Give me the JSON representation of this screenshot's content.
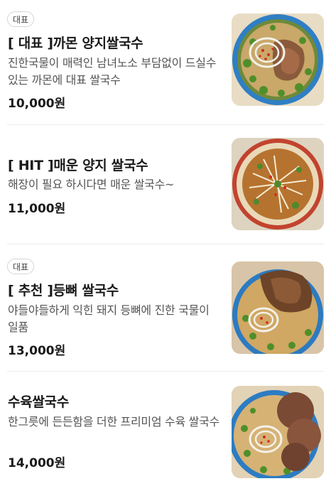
{
  "menu": {
    "currency_suffix": "원",
    "items": [
      {
        "badge": "대표",
        "title": "[ 대표 ]까몬 양지쌀국수",
        "description": "진한국물이 매력인 남녀노소 부담없이 드실수 있는 까몬에 대표 쌀국수",
        "price": "10,000원",
        "image_icon": "beef-brisket-pho-photo"
      },
      {
        "badge": "",
        "title": "[ HIT ]매운 양지 쌀국수",
        "description": "해장이 필요 하시다면 매운 쌀국수~",
        "price": "11,000원",
        "image_icon": "spicy-brisket-pho-photo"
      },
      {
        "badge": "대표",
        "title": "[ 추천 ]등뼈 쌀국수",
        "description": "야들야들하게 익힌 돼지 등뼈에 진한 국물이 일품",
        "price": "13,000원",
        "image_icon": "pork-backbone-pho-photo"
      },
      {
        "badge": "",
        "title": "수육쌀국수",
        "description": "한그릇에 든든함을 더한 프리미엄 수육 쌀국수",
        "price": "14,000원",
        "image_icon": "sliced-beef-pho-photo"
      }
    ]
  }
}
